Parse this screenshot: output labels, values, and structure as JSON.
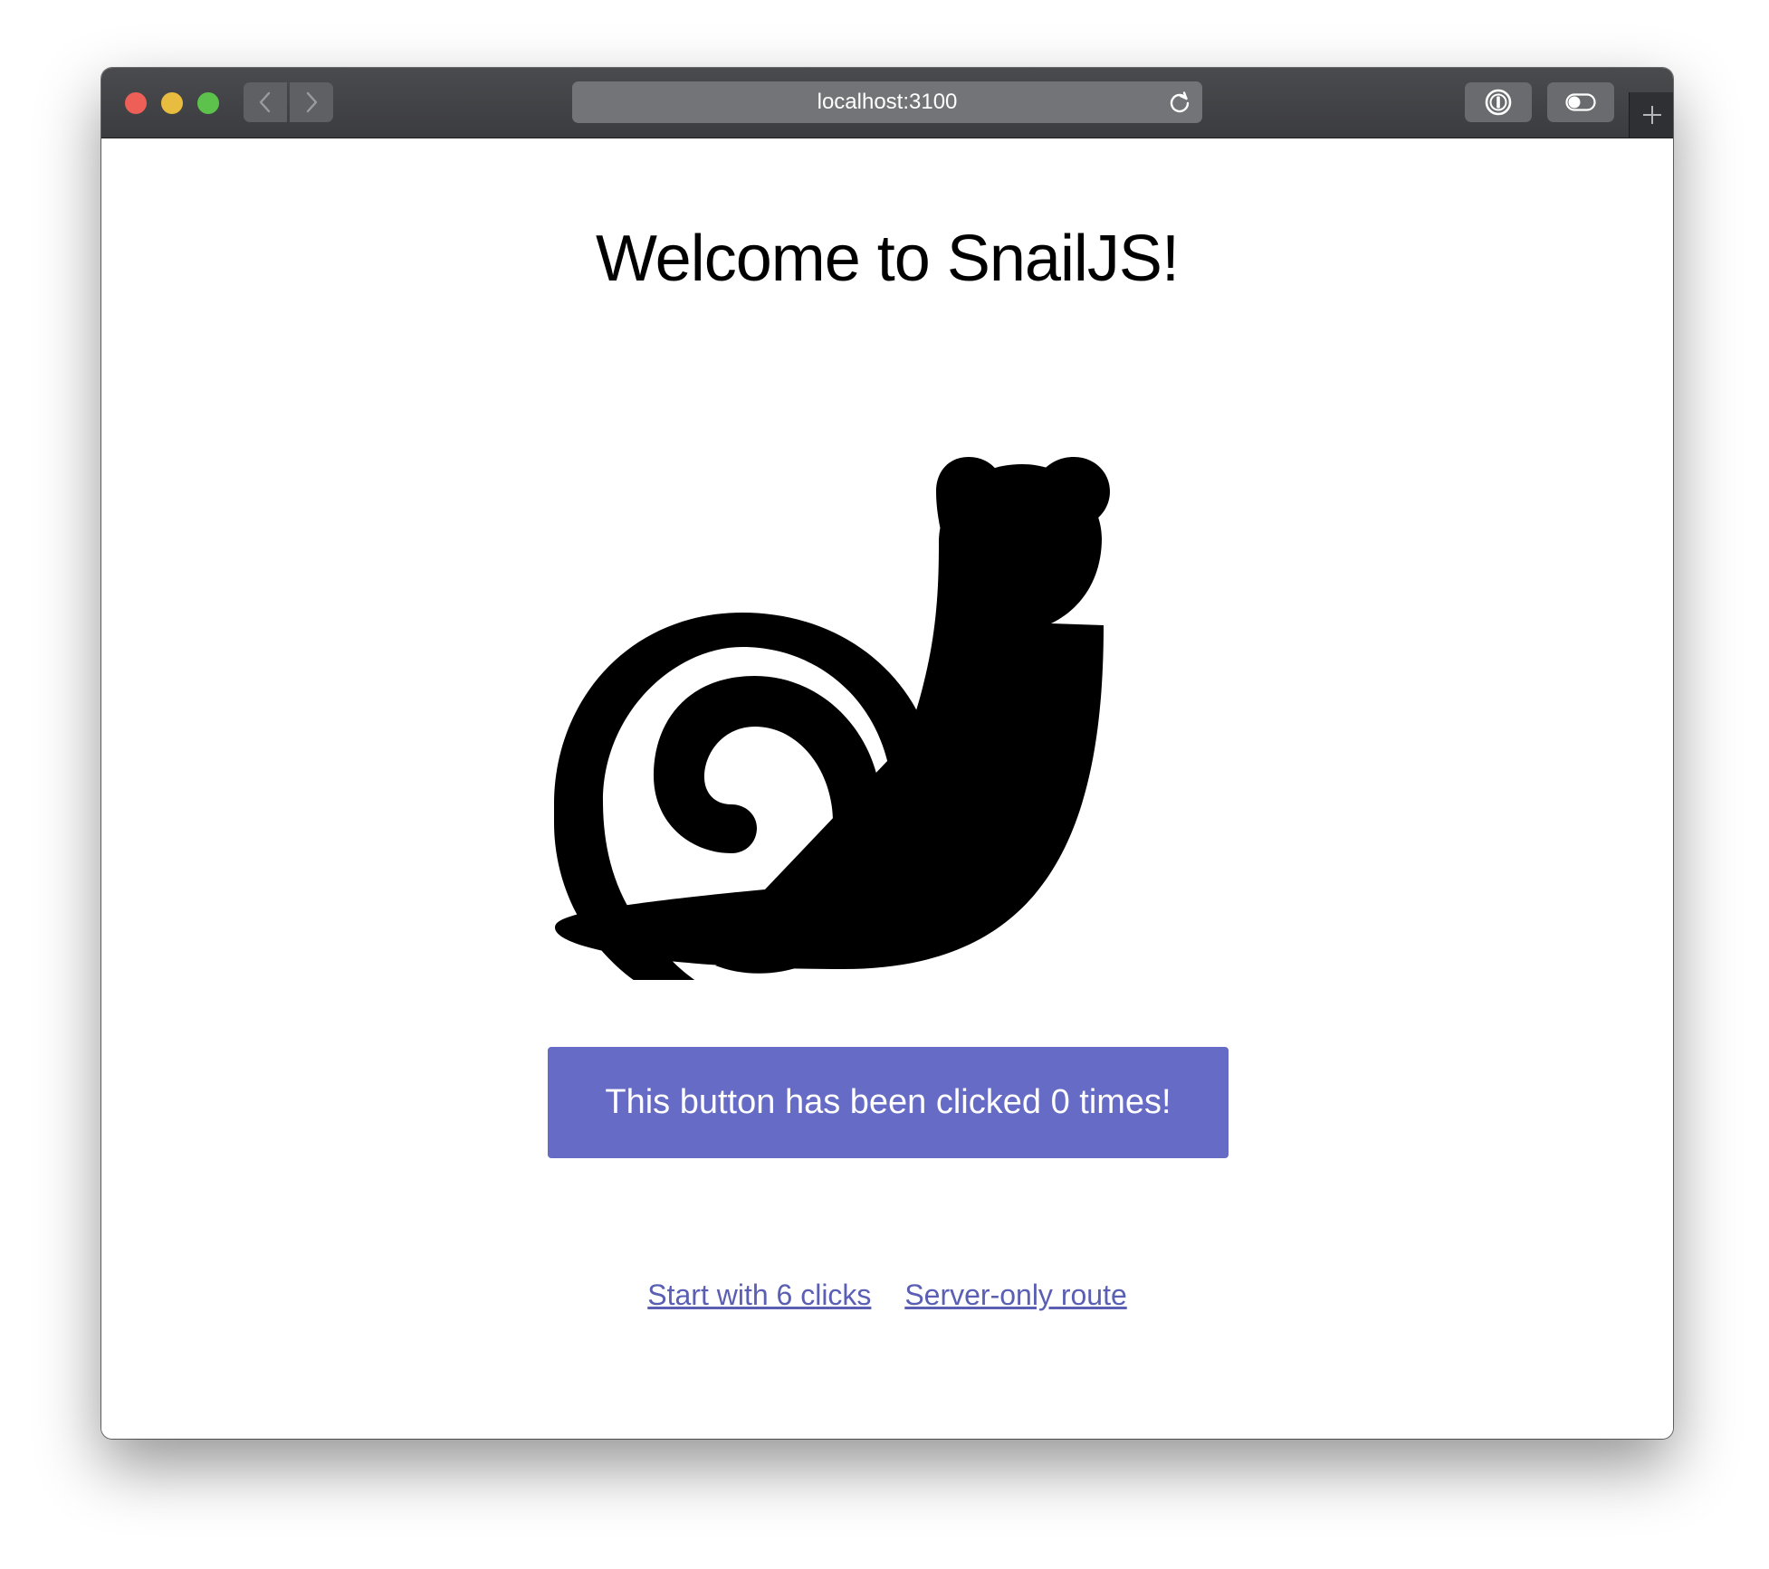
{
  "browser": {
    "address": "localhost:3100",
    "icons": {
      "back": "chevron-left-icon",
      "forward": "chevron-right-icon",
      "reload": "reload-icon",
      "password_manager": "password-manager-icon",
      "toggle": "toggle-icon",
      "new_tab": "plus-icon"
    }
  },
  "page": {
    "title": "Welcome to SnailJS!",
    "logo": "snail-icon",
    "counter_button": "This button has been clicked 0 times!",
    "links": {
      "start_with_clicks": "Start with 6 clicks",
      "server_only": "Server-only route"
    }
  },
  "colors": {
    "accent": "#666bc5",
    "link": "#5a5fb3",
    "titlebar": "#3f4043",
    "close": "#ee5f57",
    "minimize": "#e8bd3f",
    "maximize": "#5dc24b"
  }
}
